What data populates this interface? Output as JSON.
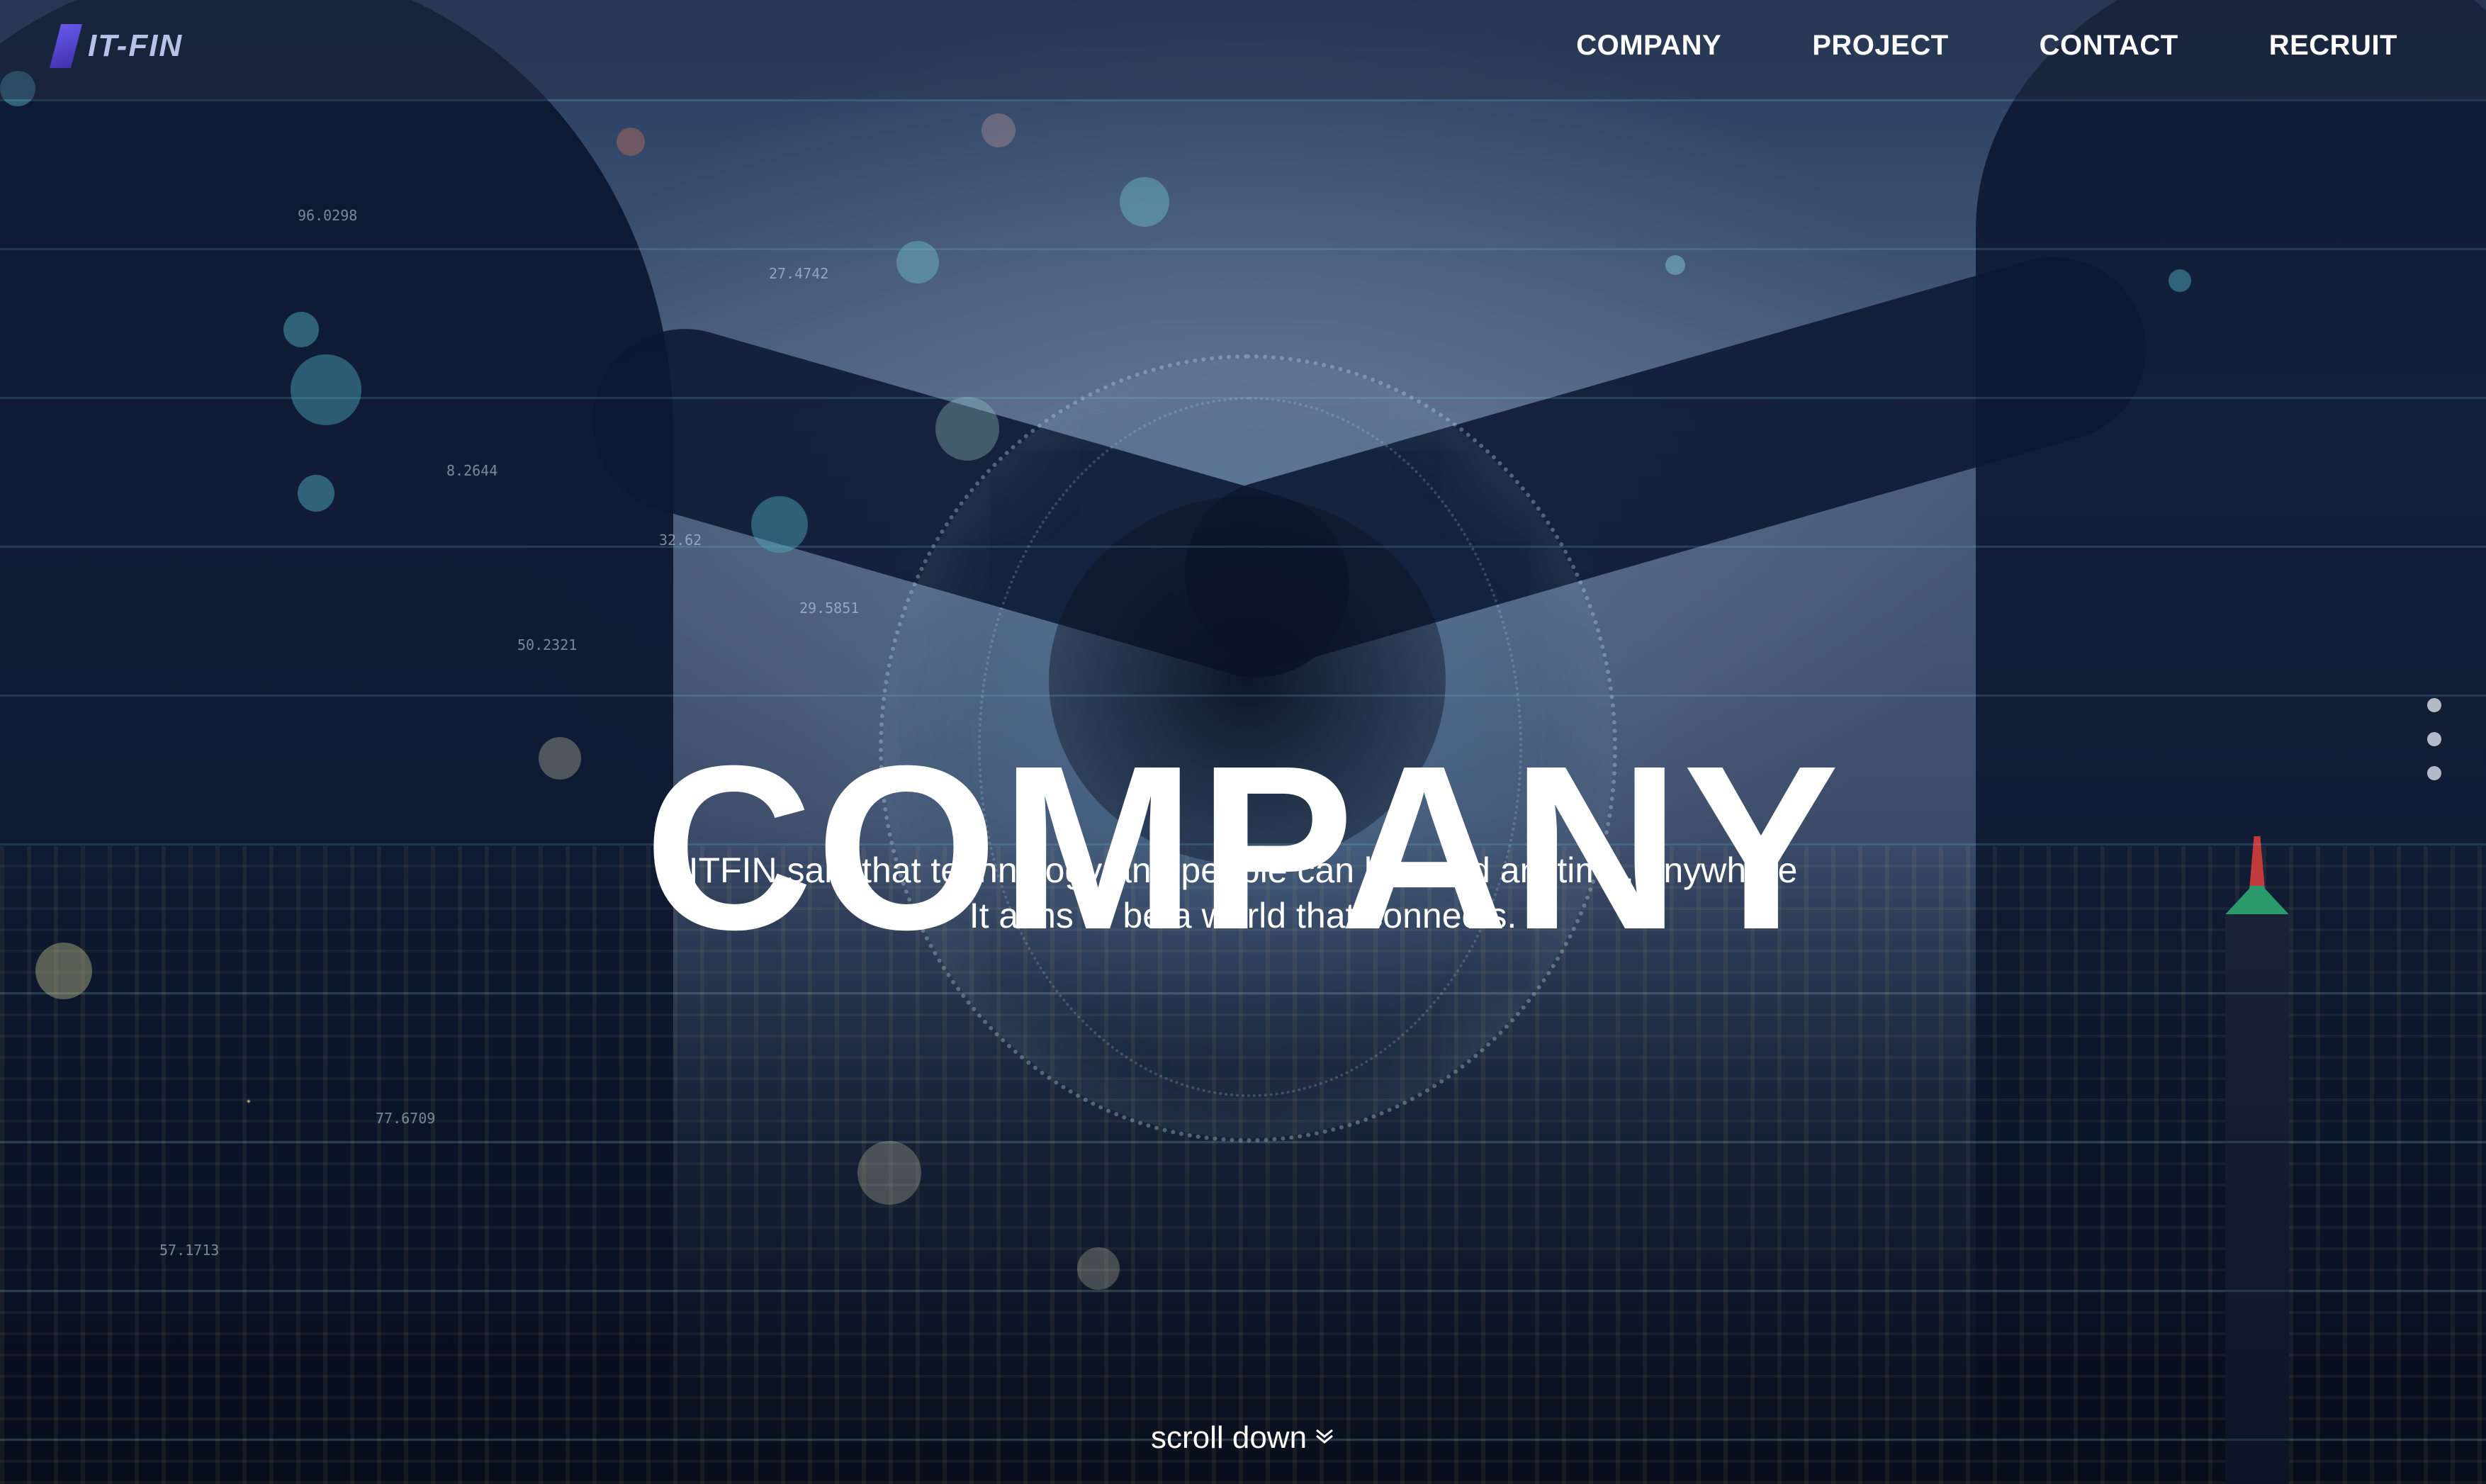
{
  "brand": {
    "logo_text": "IT-FIN"
  },
  "nav": {
    "items": [
      {
        "label": "COMPANY"
      },
      {
        "label": "PROJECT"
      },
      {
        "label": "CONTACT"
      },
      {
        "label": "RECRUIT"
      }
    ]
  },
  "hero": {
    "title": "COMPANY",
    "subtitle_line1": "ITFIN said that technology and people can be used anytime, anywhere",
    "subtitle_line2": "It aims to be a world that connects.",
    "scroll_label": "scroll down",
    "scroll_icon": "chevron-down-icon"
  },
  "background_numbers": [
    "96.0298",
    "27.4742",
    "8.2644",
    "50.2321",
    "29.5851",
    "77.6709",
    "57.1713",
    "32.62"
  ],
  "pager": {
    "count": 3
  },
  "colors": {
    "nav_text": "#ffffff",
    "logo_accent": "#6a5cf0",
    "title_text": "#ffffff"
  }
}
